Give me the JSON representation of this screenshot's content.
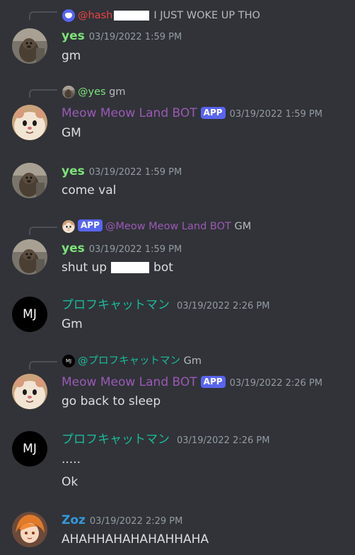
{
  "colors": {
    "background": "#313338",
    "yes": "#7ee27a",
    "meow": "#9b59b6",
    "prof": "#1abc9c",
    "zoz": "#3498db",
    "hash": "#ed4245",
    "app_badge": "#5865f2"
  },
  "messages": [
    {
      "reply": {
        "author": "@hash",
        "text": "I JUST WOKE UP THO",
        "icon": "discord-icon"
      },
      "author": "yes",
      "timestamp": "03/19/2022 1:59 PM",
      "lines": [
        "gm"
      ],
      "avatar": "otter-avatar"
    },
    {
      "reply": {
        "author": "@yes",
        "text": "gm",
        "icon": "otter-avatar"
      },
      "author": "Meow Meow Land BOT",
      "badge": "APP",
      "timestamp": "03/19/2022 1:59 PM",
      "lines": [
        "GM"
      ],
      "avatar": "hamster-avatar"
    },
    {
      "author": "yes",
      "timestamp": "03/19/2022 1:59 PM",
      "lines": [
        "come val"
      ],
      "avatar": "otter-avatar"
    },
    {
      "reply": {
        "badge": "APP",
        "author": "@Meow Meow Land BOT",
        "text": "GM",
        "icon": "hamster-avatar"
      },
      "author": "yes",
      "timestamp": "03/19/2022 1:59 PM",
      "lines": [
        "shut up",
        "bot"
      ],
      "avatar": "otter-avatar"
    },
    {
      "author": "プロフキャットマン",
      "timestamp": "03/19/2022 2:26 PM",
      "lines": [
        "Gm"
      ],
      "avatar": "mj-avatar",
      "avatar_text": "MJ"
    },
    {
      "reply": {
        "author": "@プロフキャットマン",
        "text": "Gm",
        "icon": "mj-avatar",
        "icon_text": "MJ"
      },
      "author": "Meow Meow Land BOT",
      "badge": "APP",
      "timestamp": "03/19/2022 2:26 PM",
      "lines": [
        "go back to sleep"
      ],
      "avatar": "hamster-avatar"
    },
    {
      "author": "プロフキャットマン",
      "timestamp": "03/19/2022 2:26 PM",
      "lines": [
        ".....",
        "Ok"
      ],
      "avatar": "mj-avatar",
      "avatar_text": "MJ"
    },
    {
      "author": "Zoz",
      "timestamp": "03/19/2022 2:29 PM",
      "lines": [
        "AHAHHAHAHAHAHHAHA"
      ],
      "avatar": "anime-avatar"
    }
  ]
}
